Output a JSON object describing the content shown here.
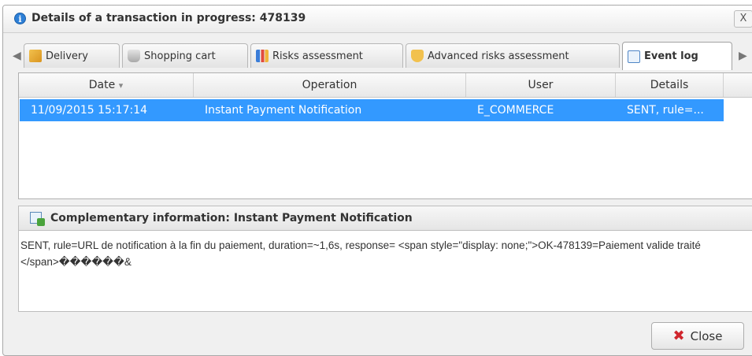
{
  "window": {
    "title": "Details of a transaction in progress: 478139",
    "close_glyph": "X"
  },
  "tabs": [
    {
      "label": "Delivery",
      "icon": "delivery-icon",
      "active": false
    },
    {
      "label": "Shopping cart",
      "icon": "shopping-cart-icon",
      "active": false
    },
    {
      "label": "Risks assessment",
      "icon": "risks-chart-icon",
      "active": false
    },
    {
      "label": "Advanced risks assessment",
      "icon": "shield-icon",
      "active": false
    },
    {
      "label": "Event log",
      "icon": "event-log-icon",
      "active": true
    }
  ],
  "grid": {
    "columns": [
      "Date",
      "Operation",
      "User",
      "Details"
    ],
    "sort_indicator": "▾",
    "rows": [
      {
        "date": "11/09/2015 15:17:14",
        "operation": "Instant Payment Notification",
        "user": "E_COMMERCE",
        "details": "SENT, rule=...",
        "selected": true
      }
    ]
  },
  "complementary": {
    "title": "Complementary information: Instant Payment Notification",
    "text": "SENT, rule=URL de notification à la fin du paiement, duration=~1,6s, response= <span style=\"display: none;\">OK-478139=Paiement valide traité </span>������&"
  },
  "footer": {
    "close_label": "Close"
  },
  "colors": {
    "selection": "#3399ff",
    "close_icon": "#d0262d",
    "info_icon": "#2d7fd6"
  }
}
